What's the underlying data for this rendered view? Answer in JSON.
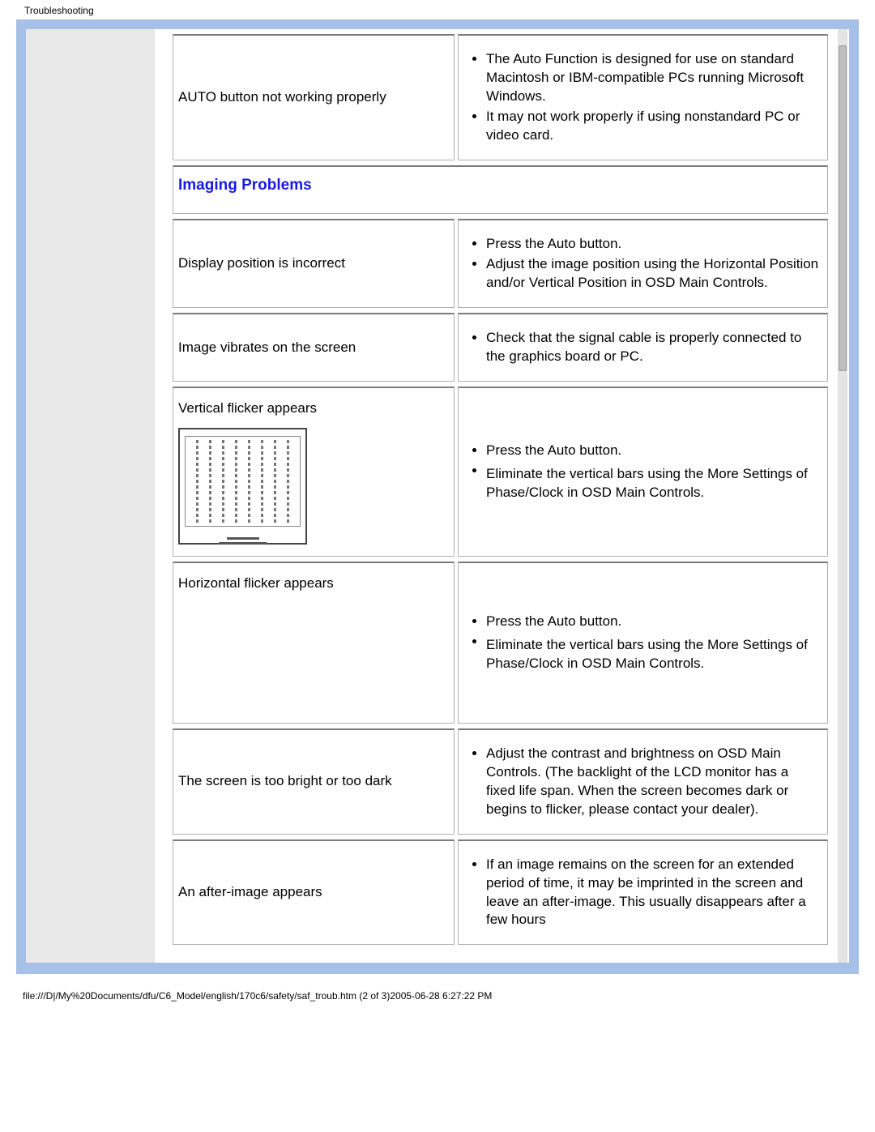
{
  "meta": {
    "title": "Troubleshooting",
    "footer_path": "file:///D|/My%20Documents/dfu/C6_Model/english/170c6/safety/saf_troub.htm (2 of 3)2005-06-28 6:27:22 PM"
  },
  "rows": [
    {
      "problem": "AUTO button not working properly",
      "solutions": [
        "The Auto Function is designed for use on standard Macintosh or IBM-compatible PCs running Microsoft Windows.",
        "It may not work properly if using nonstandard PC or video card."
      ]
    }
  ],
  "section_heading": "Imaging Problems",
  "rows2": [
    {
      "problem": "Display position is incorrect",
      "solutions": [
        "Press the Auto button.",
        "Adjust the image position using the Horizontal Position and/or Vertical Position in OSD Main Controls."
      ]
    },
    {
      "problem": "Image vibrates on the screen",
      "solutions": [
        "Check that the signal cable is properly connected to the graphics board or PC."
      ]
    },
    {
      "problem": "Vertical flicker appears",
      "illustration": true,
      "solutions": [
        "Press the Auto button.",
        "",
        "Eliminate the vertical bars using the More Settings of Phase/Clock in OSD Main Controls."
      ]
    },
    {
      "problem": "Horizontal flicker appears",
      "solutions": [
        "Press the Auto button.",
        "",
        "Eliminate the vertical bars using the More Settings of Phase/Clock in OSD Main Controls."
      ]
    },
    {
      "problem": "The screen is too bright or too dark",
      "solutions": [
        "Adjust the contrast and brightness on OSD Main Controls. (The backlight of the LCD monitor has a fixed life span. When the screen becomes dark or begins to flicker, please contact your dealer)."
      ]
    },
    {
      "problem": "An after-image appears",
      "solutions": [
        "If an image remains on the screen for an extended period of time, it may be imprinted in the screen and leave an after-image. This usually disappears after a few hours"
      ]
    }
  ]
}
